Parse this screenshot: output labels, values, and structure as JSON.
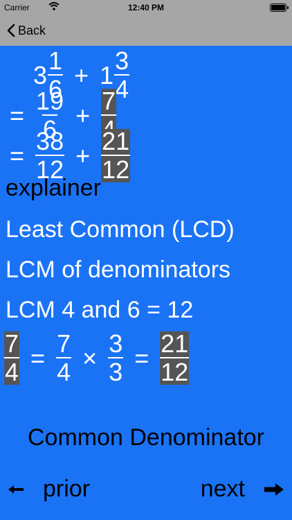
{
  "status": {
    "carrier": "Carrier",
    "time": "12:40 PM"
  },
  "nav": {
    "back_label": "Back"
  },
  "expression": {
    "a_whole": "3",
    "a_num": "1",
    "a_den": "6",
    "op": "+",
    "b_whole": "1",
    "b_num": "3",
    "b_den": "4",
    "eq": "=",
    "l2_a_num": "19",
    "l2_a_den": "6",
    "l2_b_num": "7",
    "l2_b_den": "4",
    "l3_a_num": "38",
    "l3_a_den": "12",
    "l3_b_num": "21",
    "l3_b_den": "12"
  },
  "explain": {
    "heading": "explainer",
    "line1": "Least Common (LCD)",
    "line2": "LCM of denominators",
    "line3": "LCM 4 and 6 = 12"
  },
  "conversion": {
    "f1_num": "7",
    "f1_den": "4",
    "eq": "=",
    "f2_num": "7",
    "f2_den": "4",
    "times": "×",
    "f3_num": "3",
    "f3_den": "3",
    "f4_num": "21",
    "f4_den": "12"
  },
  "footer": {
    "title": "Common Denominator",
    "prior_label": "prior",
    "next_label": "next",
    "prior_icon": "left-arrow-icon",
    "next_icon": "right-arrow-icon"
  },
  "colors": {
    "background": "#1a73f5",
    "nav_bar": "#a6a6a6",
    "highlight": "#555555"
  }
}
